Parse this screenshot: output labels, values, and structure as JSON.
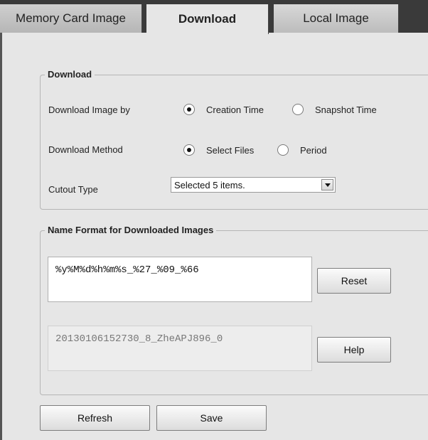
{
  "tabs": [
    {
      "label": "Memory Card Image"
    },
    {
      "label": "Download"
    },
    {
      "label": "Local Image"
    }
  ],
  "download_group": {
    "legend": "Download",
    "download_image_by": {
      "label": "Download Image by",
      "options": [
        {
          "label": "Creation Time",
          "checked": true
        },
        {
          "label": "Snapshot Time",
          "checked": false
        }
      ]
    },
    "download_method": {
      "label": "Download Method",
      "options": [
        {
          "label": "Select Files",
          "checked": true
        },
        {
          "label": "Period",
          "checked": false
        }
      ]
    },
    "cutout_type": {
      "label": "Cutout Type",
      "selected": "Selected 5 items."
    }
  },
  "name_format_group": {
    "legend": "Name Format for Downloaded Images",
    "format_value": "%y%M%d%h%m%s_%27_%09_%66",
    "preview_value": "20130106152730_8_ZheAPJ896_0",
    "reset_label": "Reset",
    "help_label": "Help"
  },
  "footer": {
    "refresh_label": "Refresh",
    "save_label": "Save"
  }
}
